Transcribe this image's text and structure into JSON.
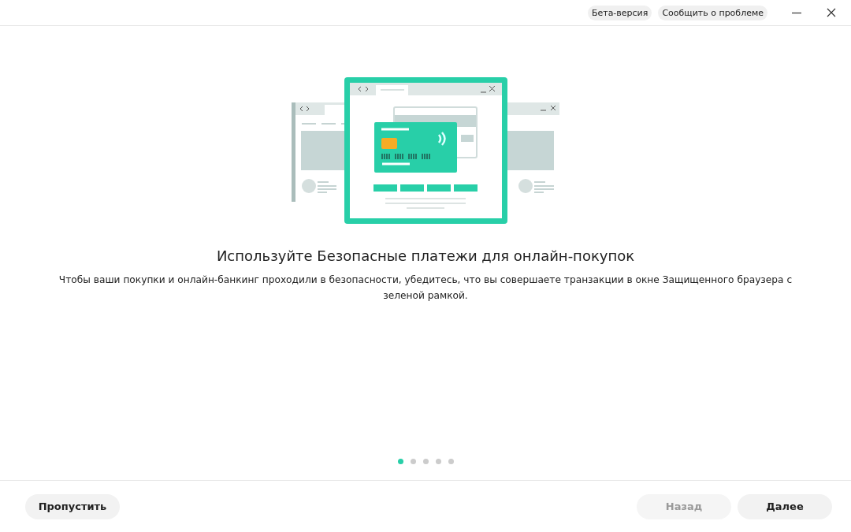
{
  "header": {
    "badges": [
      "Бета-версия",
      "Сообщить о проблеме"
    ]
  },
  "title": "Используйте Безопасные платежи для онлайн-покупок",
  "description": "Чтобы ваши покупки и онлайн-банкинг проходили в безопасности, убедитесь, что вы совершаете транзакции в окне Защищенного браузера с зеленой рамкой.",
  "pager": [
    {
      "selected": true
    },
    {
      "selected": false
    },
    {
      "selected": false
    },
    {
      "selected": false
    },
    {
      "selected": false
    }
  ],
  "footer": {
    "skip": {
      "label": "Пропустить",
      "disabled": false
    },
    "back": {
      "label": "Назад",
      "disabled": true
    },
    "next": {
      "label": "Далее",
      "disabled": false
    }
  }
}
